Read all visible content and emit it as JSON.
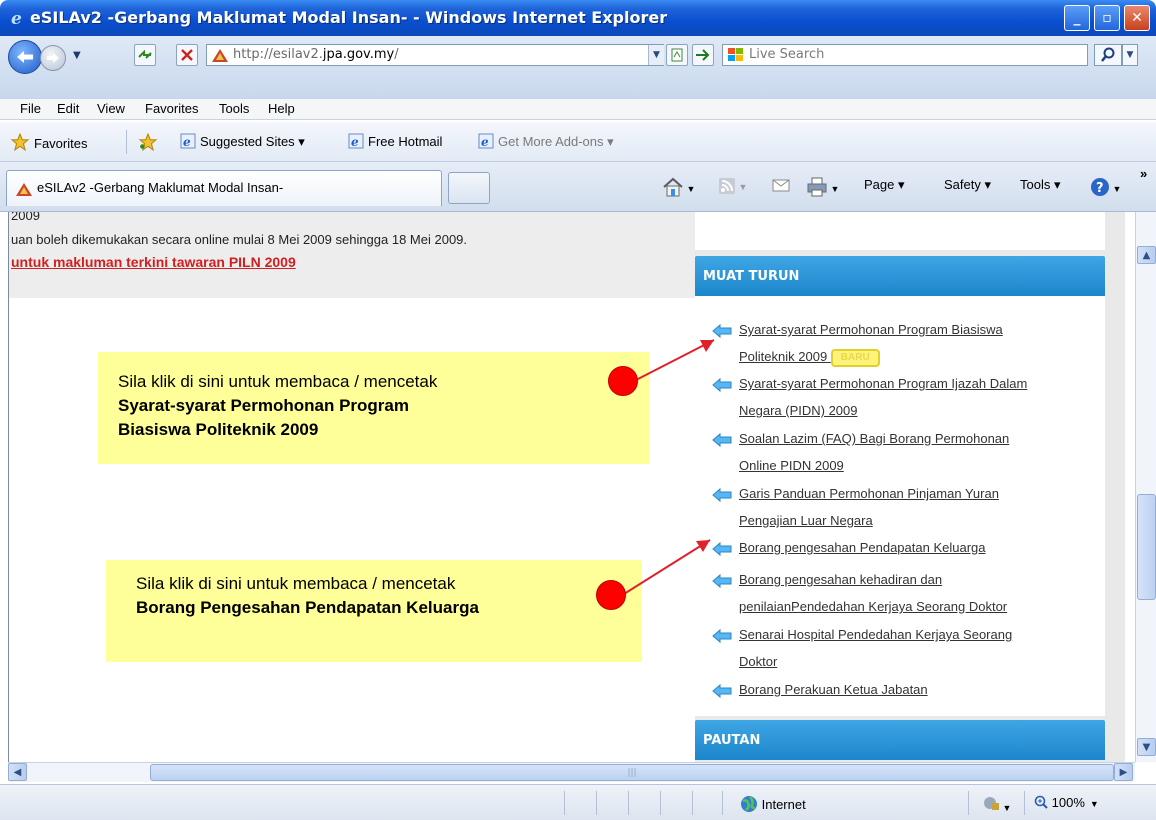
{
  "window": {
    "title": "eSILAv2 -Gerbang Maklumat Modal Insan- - Windows Internet Explorer",
    "minimize": "_",
    "maximize": "▫",
    "close": "✕"
  },
  "address_bar": {
    "url_prefix": "http://esilav2.",
    "url_domain": "jpa.gov.my",
    "url_suffix": "/",
    "search_placeholder": "Live Search"
  },
  "menu": [
    "File",
    "Edit",
    "View",
    "Favorites",
    "Tools",
    "Help"
  ],
  "favorites_bar": {
    "favorites_label": "Favorites",
    "items": [
      {
        "label": "Suggested Sites ▾",
        "enabled": true
      },
      {
        "label": "Free Hotmail",
        "enabled": true
      },
      {
        "label": "Get More Add-ons ▾",
        "enabled": false
      }
    ]
  },
  "tabs": {
    "active_title": "eSILAv2 -Gerbang Maklumat Modal Insan-"
  },
  "command_bar": {
    "page": "Page ▾",
    "safety": "Safety ▾",
    "tools": "Tools ▾",
    "overflow": "»"
  },
  "page": {
    "left": {
      "line1": "2009",
      "line2": "uan boleh dikemukakan secara online mulai 8 Mei 2009 sehingga 18 Mei 2009.",
      "link": "untuk makluman terkini tawaran PILN 2009"
    },
    "muat_turun": {
      "header": "MUAT TURUN",
      "badge": "BARU",
      "items": [
        {
          "line1": "Syarat-syarat Permohonan Program Biasiswa",
          "line2": "Politeknik 2009"
        },
        {
          "line1": "Syarat-syarat Permohonan Program Ijazah Dalam",
          "line2": "Negara (PIDN) 2009"
        },
        {
          "line1": "Soalan Lazim (FAQ) Bagi Borang Permohonan",
          "line2": "Online PIDN 2009"
        },
        {
          "line1": "Garis Panduan Permohonan Pinjaman Yuran",
          "line2": "Pengajian Luar Negara"
        },
        {
          "line1": "Borang pengesahan Pendapatan Keluarga",
          "line2": ""
        },
        {
          "line1": "Borang pengesahan kehadiran dan",
          "line2": "penilaianPendedahan Kerjaya Seorang Doktor"
        },
        {
          "line1": "Senarai Hospital Pendedahan Kerjaya Seorang",
          "line2": "Doktor"
        },
        {
          "line1": "Borang Perakuan Ketua Jabatan",
          "line2": ""
        }
      ]
    },
    "pautan": {
      "header": "PAUTAN"
    }
  },
  "callouts": [
    {
      "line1": "Sila klik di sini untuk membaca / mencetak",
      "bold1": "Syarat-syarat Permohonan Program",
      "bold2": "Biasiswa Politeknik 2009"
    },
    {
      "line1": "Sila klik di sini untuk membaca / mencetak",
      "bold1": "Borang Pengesahan Pendapatan Keluarga"
    }
  ],
  "status_bar": {
    "zone": "Internet",
    "zoom": "100%"
  },
  "colors": {
    "panel_header": "#2a96d8",
    "callout_bg": "#ffff99",
    "link_red": "#d21f1f",
    "arrow_red": "#e0202a"
  }
}
